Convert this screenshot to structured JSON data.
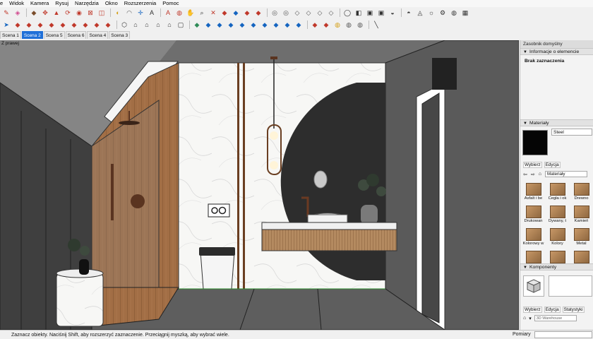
{
  "menubar": {
    "items": [
      "e",
      "Widok",
      "Kamera",
      "Rysuj",
      "Narzędzia",
      "Okno",
      "Rozszerzenia",
      "Pomoc"
    ]
  },
  "toolbar1": {
    "icons": [
      {
        "name": "pencil-icon",
        "glyph": "✎",
        "color": "#c0392b"
      },
      {
        "name": "eraser-icon",
        "glyph": "◈",
        "color": "#d14b8f"
      },
      {
        "name": "paint-bucket-icon",
        "glyph": "◆",
        "color": "#7a4d2b"
      },
      {
        "name": "move-icon",
        "glyph": "✥",
        "color": "#c0392b"
      },
      {
        "name": "push-pull-icon",
        "glyph": "▲",
        "color": "#c0392b"
      },
      {
        "name": "rotate-icon",
        "glyph": "⟳",
        "color": "#c0392b"
      },
      {
        "name": "follow-me-icon",
        "glyph": "◉",
        "color": "#c0392b"
      },
      {
        "name": "scale-icon",
        "glyph": "⊠",
        "color": "#c0392b"
      },
      {
        "name": "offset-icon",
        "glyph": "◫",
        "color": "#c0392b"
      },
      {
        "name": "tape-measure-icon",
        "glyph": "◐",
        "color": "#d4a017"
      },
      {
        "name": "protractor-icon",
        "glyph": "◠",
        "color": "#555555"
      },
      {
        "name": "axes-icon",
        "glyph": "✛",
        "color": "#1565c0"
      },
      {
        "name": "text-icon",
        "glyph": "A",
        "color": "#333333"
      },
      {
        "name": "3d-text-icon",
        "glyph": "A",
        "color": "#c0392b"
      },
      {
        "name": "orbit-icon",
        "glyph": "◍",
        "color": "#c0392b"
      },
      {
        "name": "pan-icon",
        "glyph": "✋",
        "color": "#333333"
      },
      {
        "name": "zoom-icon",
        "glyph": "⌕",
        "color": "#333333"
      },
      {
        "name": "zoom-extents-icon",
        "glyph": "✕",
        "color": "#c0392b"
      },
      {
        "name": "3d-warehouse-icon",
        "glyph": "◆",
        "color": "#c0392b"
      },
      {
        "name": "extension-warehouse-icon",
        "glyph": "◆",
        "color": "#1565c0"
      },
      {
        "name": "layout-icon",
        "glyph": "◆",
        "color": "#c0392b"
      },
      {
        "name": "ruby-icon",
        "glyph": "◆",
        "color": "#c0392b"
      },
      {
        "name": "xray-icon",
        "glyph": "◎",
        "color": "#555555"
      },
      {
        "name": "back-edges-icon",
        "glyph": "◎",
        "color": "#555555"
      },
      {
        "name": "wireframe-icon",
        "glyph": "◇",
        "color": "#555555"
      },
      {
        "name": "hidden-line-icon",
        "glyph": "◇",
        "color": "#555555"
      },
      {
        "name": "shaded-icon",
        "glyph": "◇",
        "color": "#555555"
      },
      {
        "name": "textured-icon",
        "glyph": "◇",
        "color": "#555555"
      },
      {
        "name": "monochrome-icon",
        "glyph": "◯",
        "color": "#333333"
      },
      {
        "name": "section-plane-icon",
        "glyph": "◧",
        "color": "#333333"
      },
      {
        "name": "display-section-cuts-icon",
        "glyph": "▣",
        "color": "#333333"
      },
      {
        "name": "display-section-fill-icon",
        "glyph": "▣",
        "color": "#333333"
      },
      {
        "name": "shadows-icon",
        "glyph": "◒",
        "color": "#333333"
      },
      {
        "name": "fog-icon",
        "glyph": "◓",
        "color": "#333333"
      },
      {
        "name": "sandbox-icon",
        "glyph": "◬",
        "color": "#333333"
      },
      {
        "name": "sun-icon",
        "glyph": "☼",
        "color": "#333333"
      },
      {
        "name": "gear-icon",
        "glyph": "⚙",
        "color": "#333333"
      },
      {
        "name": "globe-icon",
        "glyph": "◍",
        "color": "#333333"
      },
      {
        "name": "grid-icon",
        "glyph": "▦",
        "color": "#333333"
      }
    ]
  },
  "toolbar2": {
    "icons": [
      {
        "name": "select-icon",
        "glyph": "➤",
        "color": "#1565c0"
      },
      {
        "name": "component-icon",
        "glyph": "◆",
        "color": "#c0392b"
      },
      {
        "name": "rectangle-icon",
        "glyph": "◆",
        "color": "#c0392b"
      },
      {
        "name": "circle-icon",
        "glyph": "◆",
        "color": "#c0392b"
      },
      {
        "name": "polygon-icon",
        "glyph": "◆",
        "color": "#c0392b"
      },
      {
        "name": "arc-icon",
        "glyph": "◆",
        "color": "#c0392b"
      },
      {
        "name": "line-icon",
        "glyph": "◆",
        "color": "#c0392b"
      },
      {
        "name": "freehand-icon",
        "glyph": "◆",
        "color": "#c0392b"
      },
      {
        "name": "outliner-icon",
        "glyph": "◆",
        "color": "#c0392b"
      },
      {
        "name": "tag-icon",
        "glyph": "◆",
        "color": "#c0392b"
      },
      {
        "name": "iso-view-icon",
        "glyph": "⬡",
        "color": "#333333"
      },
      {
        "name": "top-view-icon",
        "glyph": "⌂",
        "color": "#333333"
      },
      {
        "name": "front-view-icon",
        "glyph": "⌂",
        "color": "#333333"
      },
      {
        "name": "right-view-icon",
        "glyph": "⌂",
        "color": "#333333"
      },
      {
        "name": "back-view-icon",
        "glyph": "⌂",
        "color": "#333333"
      },
      {
        "name": "left-view-icon",
        "glyph": "▢",
        "color": "#333333"
      },
      {
        "name": "materials-icon",
        "glyph": "◆",
        "color": "#2e8b57"
      },
      {
        "name": "styles-icon",
        "glyph": "◆",
        "color": "#1565c0"
      },
      {
        "name": "scene-icon",
        "glyph": "◆",
        "color": "#1565c0"
      },
      {
        "name": "layer-icon",
        "glyph": "◆",
        "color": "#1565c0"
      },
      {
        "name": "entity-info-icon",
        "glyph": "◆",
        "color": "#1565c0"
      },
      {
        "name": "shadow-settings-icon",
        "glyph": "◆",
        "color": "#1565c0"
      },
      {
        "name": "fog-settings-icon",
        "glyph": "◆",
        "color": "#1565c0"
      },
      {
        "name": "soften-edges-icon",
        "glyph": "◆",
        "color": "#1565c0"
      },
      {
        "name": "intersect-icon",
        "glyph": "◆",
        "color": "#1565c0"
      },
      {
        "name": "solid-tools-icon",
        "glyph": "◆",
        "color": "#1565c0"
      },
      {
        "name": "flip-icon",
        "glyph": "◆",
        "color": "#c0392b"
      },
      {
        "name": "mirror-icon",
        "glyph": "◆",
        "color": "#c0392b"
      },
      {
        "name": "plugin-a-icon",
        "glyph": "◍",
        "color": "#d4a017"
      },
      {
        "name": "plugin-b-icon",
        "glyph": "◍",
        "color": "#555555"
      },
      {
        "name": "plugin-c-icon",
        "glyph": "◍",
        "color": "#555555"
      },
      {
        "name": "measure-line-icon",
        "glyph": "╲",
        "color": "#333333"
      }
    ]
  },
  "scene_tabs": {
    "tabs": [
      "Scena 1",
      "Scena 2",
      "Scena 5",
      "Scena 6",
      "Scena 4",
      "Scena 3"
    ],
    "active_index": 1
  },
  "viewport": {
    "camera_label": "Z prawej"
  },
  "tray": {
    "title": "Zasobnik domyślny",
    "entity_info": {
      "header": "Informacje o elemencie",
      "value": "Brak zaznaczenia"
    },
    "materials": {
      "header": "Materiały",
      "current_name": "Steel",
      "swatch_color": "#050505",
      "tabs": [
        "Wybierz",
        "Edycja"
      ],
      "library": "Materiały",
      "items": [
        "Asfalt i be",
        "Cegła i ok",
        "Drewno",
        "Drukowan",
        "Dywany, t",
        "Kamień",
        "Kolorowy w",
        "Kolory",
        "Metal",
        "",
        "",
        ""
      ]
    },
    "components": {
      "header": "Komponenty",
      "tabs": [
        "Wybierz",
        "Edycja",
        "Statystyki"
      ],
      "search_placeholder": "3D Warehouse"
    }
  },
  "status": {
    "text": "Zaznacz obiekty. Naciśnij Shift, aby rozszerzyć zaznaczenie. Przeciągnij myszką, aby wybrać wiele.",
    "measurement_label": "Pomiary",
    "measurement_value": ""
  }
}
